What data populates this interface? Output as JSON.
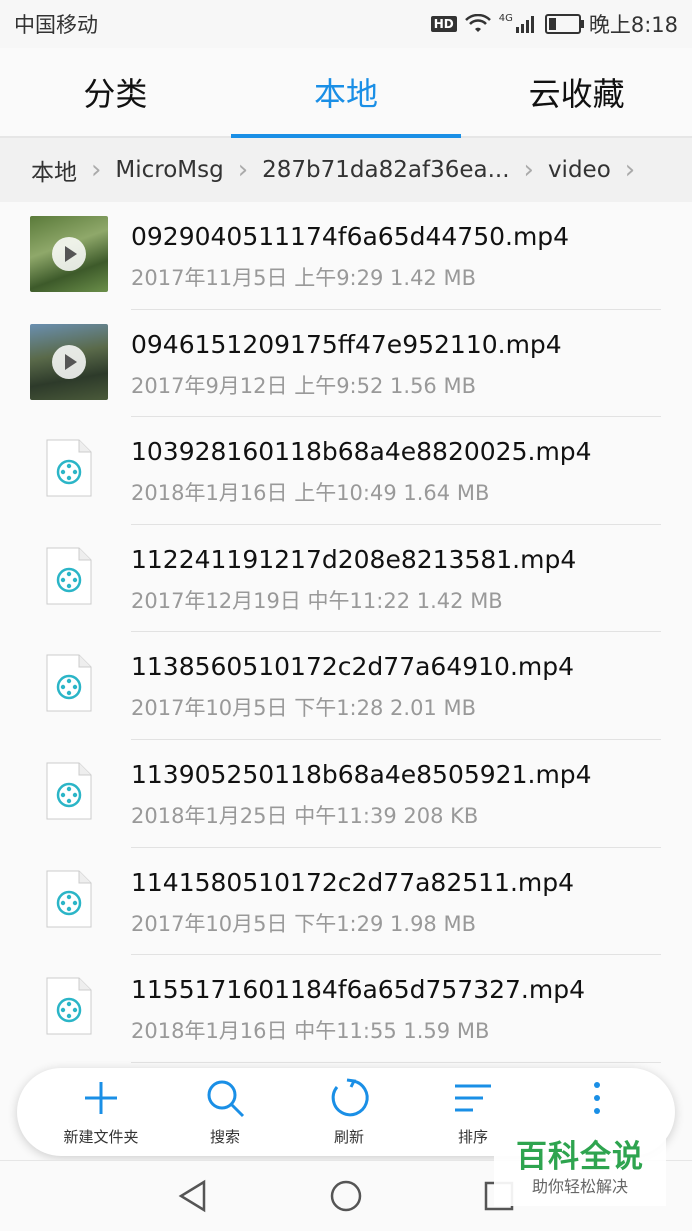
{
  "status_bar": {
    "carrier": "中国移动",
    "hd_badge": "HD",
    "network": "4G",
    "time": "晚上8:18"
  },
  "tabs": [
    {
      "label": "分类"
    },
    {
      "label": "本地",
      "active": true
    },
    {
      "label": "云收藏"
    }
  ],
  "breadcrumb": [
    {
      "label": "本地"
    },
    {
      "label": "MicroMsg"
    },
    {
      "label": "287b71da82af36ea..."
    },
    {
      "label": "video"
    }
  ],
  "files": [
    {
      "name": "0929040511174f6a65d44750.mp4",
      "meta": "2017年11月5日 上午9:29 1.42 MB",
      "thumb": "video-thumbnail"
    },
    {
      "name": "0946151209175ff47e952110.mp4",
      "meta": "2017年9月12日 上午9:52 1.56 MB",
      "thumb": "video-thumbnail"
    },
    {
      "name": "103928160118b68a4e8820025.mp4",
      "meta": "2018年1月16日 上午10:49 1.64 MB",
      "thumb": "video-file-icon"
    },
    {
      "name": "112241191217d208e8213581.mp4",
      "meta": "2017年12月19日 中午11:22 1.42 MB",
      "thumb": "video-file-icon"
    },
    {
      "name": "1138560510172c2d77a64910.mp4",
      "meta": "2017年10月5日 下午1:28 2.01 MB",
      "thumb": "video-file-icon"
    },
    {
      "name": "113905250118b68a4e8505921.mp4",
      "meta": "2018年1月25日 中午11:39 208 KB",
      "thumb": "video-file-icon"
    },
    {
      "name": "1141580510172c2d77a82511.mp4",
      "meta": "2017年10月5日 下午1:29 1.98 MB",
      "thumb": "video-file-icon"
    },
    {
      "name": "1155171601184f6a65d757327.mp4",
      "meta": "2018年1月16日 中午11:55 1.59 MB",
      "thumb": "video-file-icon"
    }
  ],
  "toolbar": {
    "new_folder": "新建文件夹",
    "search": "搜索",
    "refresh": "刷新",
    "sort": "排序"
  },
  "watermark": {
    "title": "百科全说",
    "subtitle": "助你轻松解决"
  },
  "colors": {
    "accent": "#1a8fe6",
    "file_icon": "#2bb5c7",
    "watermark": "#2ea44f"
  }
}
